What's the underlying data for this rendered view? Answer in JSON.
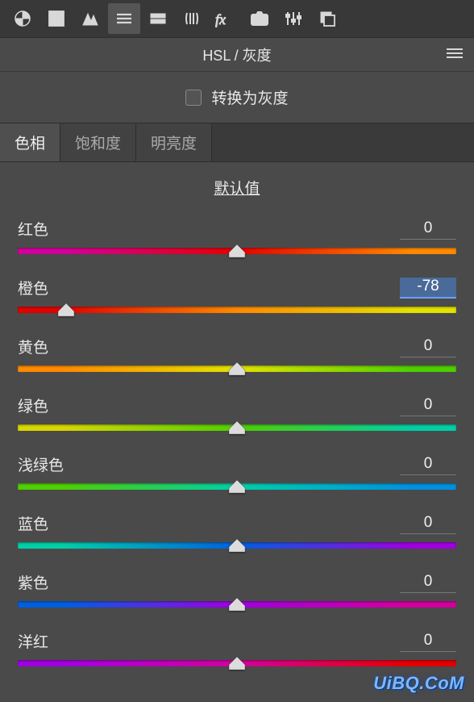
{
  "panel": {
    "title": "HSL / 灰度",
    "convert_label": "转换为灰度",
    "default_label": "默认值"
  },
  "tabs": [
    {
      "label": "色相",
      "active": true
    },
    {
      "label": "饱和度",
      "active": false
    },
    {
      "label": "明亮度",
      "active": false
    }
  ],
  "sliders": [
    {
      "label": "红色",
      "value": "0",
      "pos": 50,
      "editing": false,
      "grad": "g-red"
    },
    {
      "label": "橙色",
      "value": "-78",
      "pos": 11,
      "editing": true,
      "grad": "g-orange"
    },
    {
      "label": "黄色",
      "value": "0",
      "pos": 50,
      "editing": false,
      "grad": "g-yellow"
    },
    {
      "label": "绿色",
      "value": "0",
      "pos": 50,
      "editing": false,
      "grad": "g-green"
    },
    {
      "label": "浅绿色",
      "value": "0",
      "pos": 50,
      "editing": false,
      "grad": "g-aqua"
    },
    {
      "label": "蓝色",
      "value": "0",
      "pos": 50,
      "editing": false,
      "grad": "g-blue"
    },
    {
      "label": "紫色",
      "value": "0",
      "pos": 50,
      "editing": false,
      "grad": "g-purple"
    },
    {
      "label": "洋红",
      "value": "0",
      "pos": 50,
      "editing": false,
      "grad": "g-magenta"
    }
  ],
  "watermark": "UiBQ.CoM"
}
